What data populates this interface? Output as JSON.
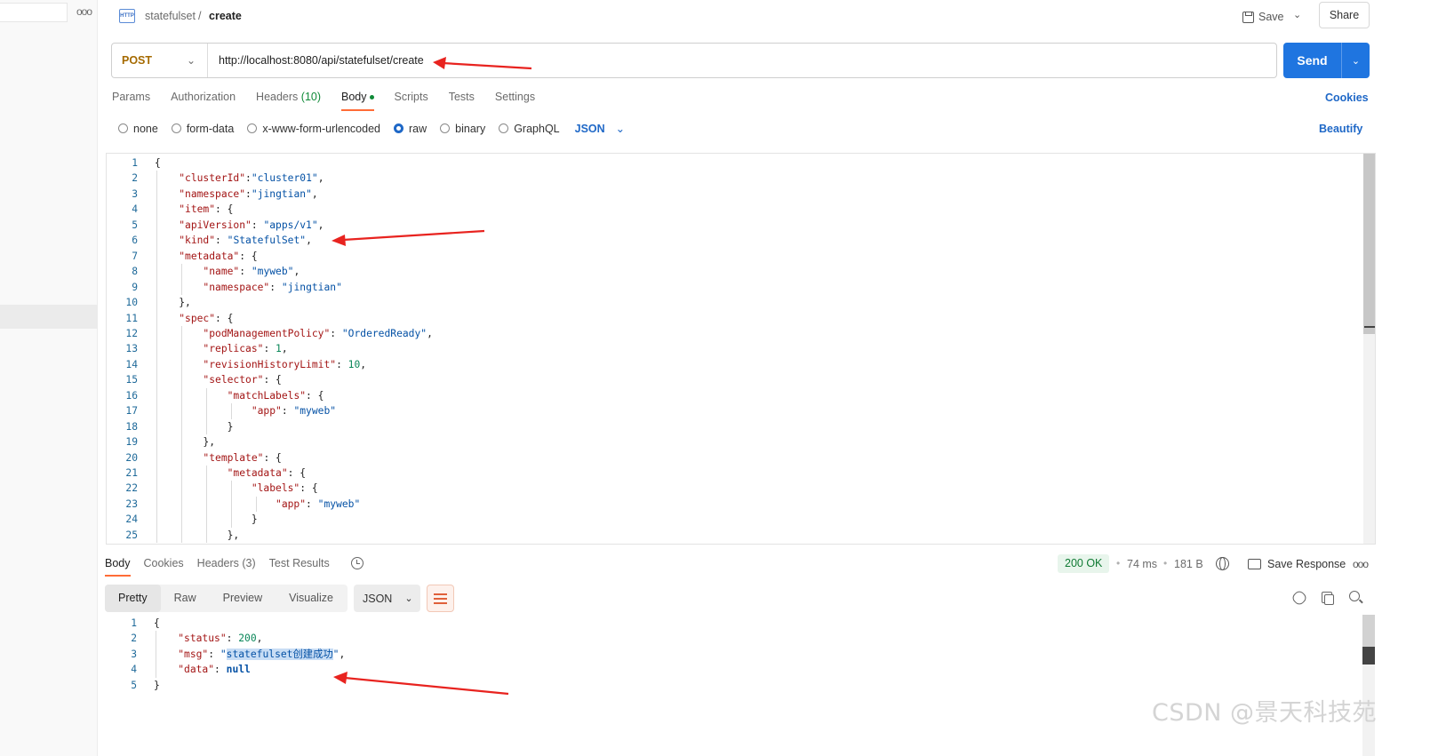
{
  "breadcrumb": {
    "parent": "statefulset",
    "separator": "/",
    "current": "create",
    "icon": "http-icon"
  },
  "header": {
    "save_label": "Save",
    "share_label": "Share"
  },
  "request": {
    "method": "POST",
    "url": "http://localhost:8080/api/statefulset/create",
    "send_label": "Send"
  },
  "request_tabs": [
    {
      "label": "Params"
    },
    {
      "label": "Authorization"
    },
    {
      "label": "Headers",
      "count": "(10)"
    },
    {
      "label": "Body"
    },
    {
      "label": "Scripts"
    },
    {
      "label": "Tests"
    },
    {
      "label": "Settings"
    }
  ],
  "cookies_label": "Cookies",
  "body_types": [
    "none",
    "form-data",
    "x-www-form-urlencoded",
    "raw",
    "binary",
    "GraphQL"
  ],
  "body_type_selected": "raw",
  "body_format": "JSON",
  "beautify_label": "Beautify",
  "request_body_lines": [
    "{",
    "    \"clusterId\":\"cluster01\",",
    "    \"namespace\":\"jingtian\",",
    "    \"item\": {",
    "    \"apiVersion\": \"apps/v1\",",
    "    \"kind\": \"StatefulSet\",",
    "    \"metadata\": {",
    "        \"name\": \"myweb\",",
    "        \"namespace\": \"jingtian\"",
    "    },",
    "    \"spec\": {",
    "        \"podManagementPolicy\": \"OrderedReady\",",
    "        \"replicas\": 1,",
    "        \"revisionHistoryLimit\": 10,",
    "        \"selector\": {",
    "            \"matchLabels\": {",
    "                \"app\": \"myweb\"",
    "            }",
    "        },",
    "        \"template\": {",
    "            \"metadata\": {",
    "                \"labels\": {",
    "                    \"app\": \"myweb\"",
    "                }",
    "            },"
  ],
  "response_tabs": [
    {
      "label": "Body"
    },
    {
      "label": "Cookies"
    },
    {
      "label": "Headers (3)"
    },
    {
      "label": "Test Results"
    }
  ],
  "response_meta": {
    "status": "200 OK",
    "time": "74 ms",
    "size": "181 B",
    "save_response_label": "Save Response"
  },
  "response_views": [
    "Pretty",
    "Raw",
    "Preview",
    "Visualize"
  ],
  "response_format": "JSON",
  "response_body_lines": [
    "{",
    "    \"status\": 200,",
    "    \"msg\": \"statefulset创建成功\",",
    "    \"data\": null",
    "}"
  ],
  "watermark": "CSDN @景天科技苑",
  "colors": {
    "accent": "#1f75e0",
    "tab_indicator": "#ff6c37",
    "annotation_arrow": "#e8231f",
    "status_ok": "#0f7a33"
  }
}
